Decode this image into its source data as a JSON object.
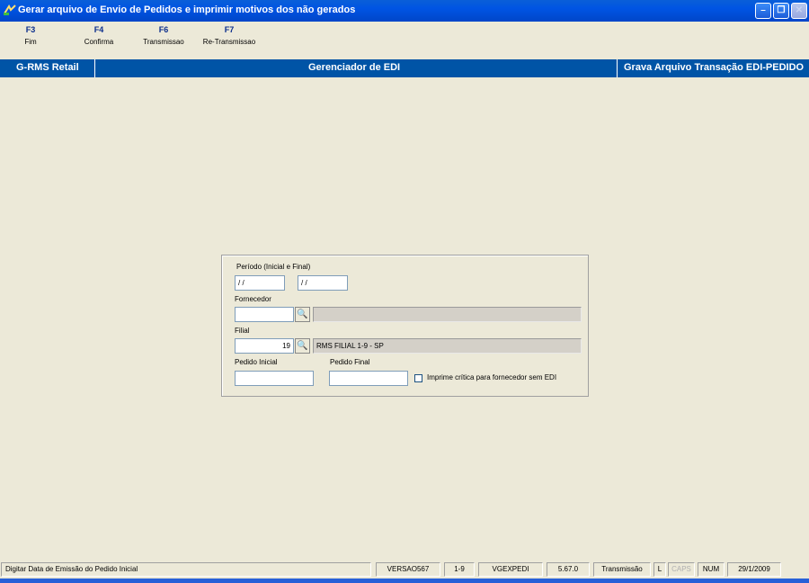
{
  "window": {
    "title": "Gerar arquivo de Envio de Pedidos e imprimir motivos dos não gerados"
  },
  "fkeys": [
    {
      "key": "F3",
      "label": "Fim"
    },
    {
      "key": "F4",
      "label": "Confirma"
    },
    {
      "key": "F6",
      "label": "Transmissao"
    },
    {
      "key": "F7",
      "label": "Re-Transmissao"
    }
  ],
  "header": {
    "left": "G-RMS Retail",
    "center": "Gerenciador de EDI",
    "right": "Grava Arquivo Transação EDI-PEDIDO"
  },
  "form": {
    "periodo_label": "Período (Inicial e Final)",
    "periodo_inicial": "/ /",
    "periodo_final": "/ /",
    "fornecedor_label": "Fornecedor",
    "fornecedor_code": "",
    "fornecedor_name": "",
    "filial_label": "Filial",
    "filial_code": "19",
    "filial_name": "RMS FILIAL 1-9 - SP",
    "pedido_inicial_label": "Pedido Inicial",
    "pedido_inicial": "",
    "pedido_final_label": "Pedido Final",
    "pedido_final": "",
    "imprime_label": "Imprime crítica para fornecedor sem EDI",
    "imprime_checked": false
  },
  "status": {
    "message": "Digitar Data de Emissão do Pedido Inicial",
    "version": "VERSAO567",
    "filial": "1-9",
    "program": "VGEXPEDI",
    "build": "5.67.0",
    "mode": "Transmissão",
    "l": "L",
    "caps": "CAPS",
    "num": "NUM",
    "date": "29/1/2009"
  },
  "colors": {
    "titlebar": "#0054E3",
    "header_bar": "#0054A6",
    "background": "#ECE9D8",
    "fkey_text": "#0A2D8C"
  },
  "icons": {
    "lookup": "binoculars-icon",
    "app": "app-icon"
  }
}
